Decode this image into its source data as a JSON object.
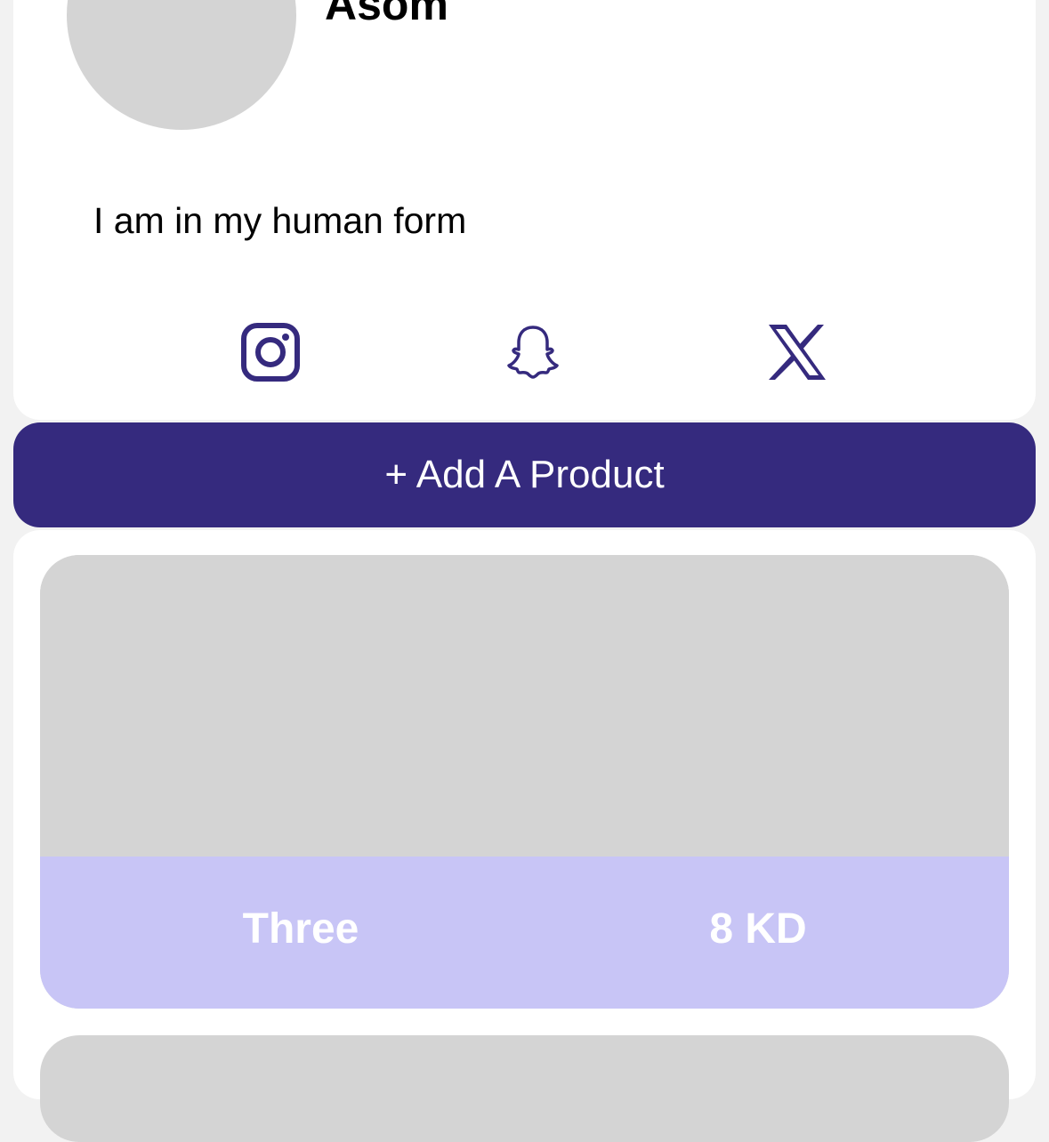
{
  "profile": {
    "name": "Asom",
    "bio": "I am in my human form"
  },
  "social": [
    {
      "icon": "instagram-icon"
    },
    {
      "icon": "snapchat-icon"
    },
    {
      "icon": "x-icon"
    }
  ],
  "actions": {
    "add_product_label": "+ Add A Product"
  },
  "products": [
    {
      "name": "Three",
      "price": "8 KD"
    }
  ],
  "colors": {
    "accent": "#352a7e",
    "product_footer": "#c8c5f6",
    "placeholder": "#d4d4d4",
    "background": "#f2f2f2"
  }
}
